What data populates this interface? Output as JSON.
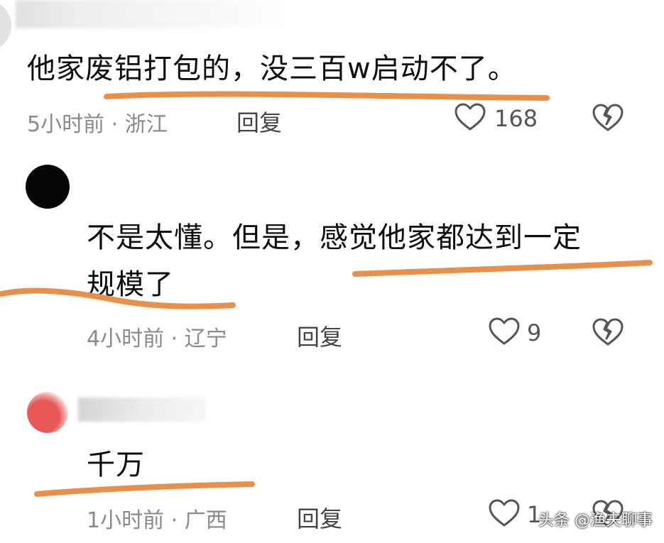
{
  "comments": [
    {
      "text": "他家废铝打包的，没三百w启动不了。",
      "time_location": "5小时前 · 浙江",
      "reply_label": "回复",
      "like_count": "168"
    },
    {
      "text_line1": "不是太懂。但是，感觉他家都达到一定",
      "text_line2": "规模了",
      "time_location": "4小时前 · 辽宁",
      "reply_label": "回复",
      "like_count": "9"
    },
    {
      "text": "千万",
      "time_location": "1小时前 · 广西",
      "reply_label": "回复",
      "like_count": "1"
    }
  ],
  "watermark": "头条 @渔夫聊事",
  "colors": {
    "annotation_line": "#e8904a",
    "meta_text": "#8a8a8a",
    "icon_stroke": "#555555"
  },
  "icons": [
    "heart-icon",
    "broken-heart-icon"
  ]
}
